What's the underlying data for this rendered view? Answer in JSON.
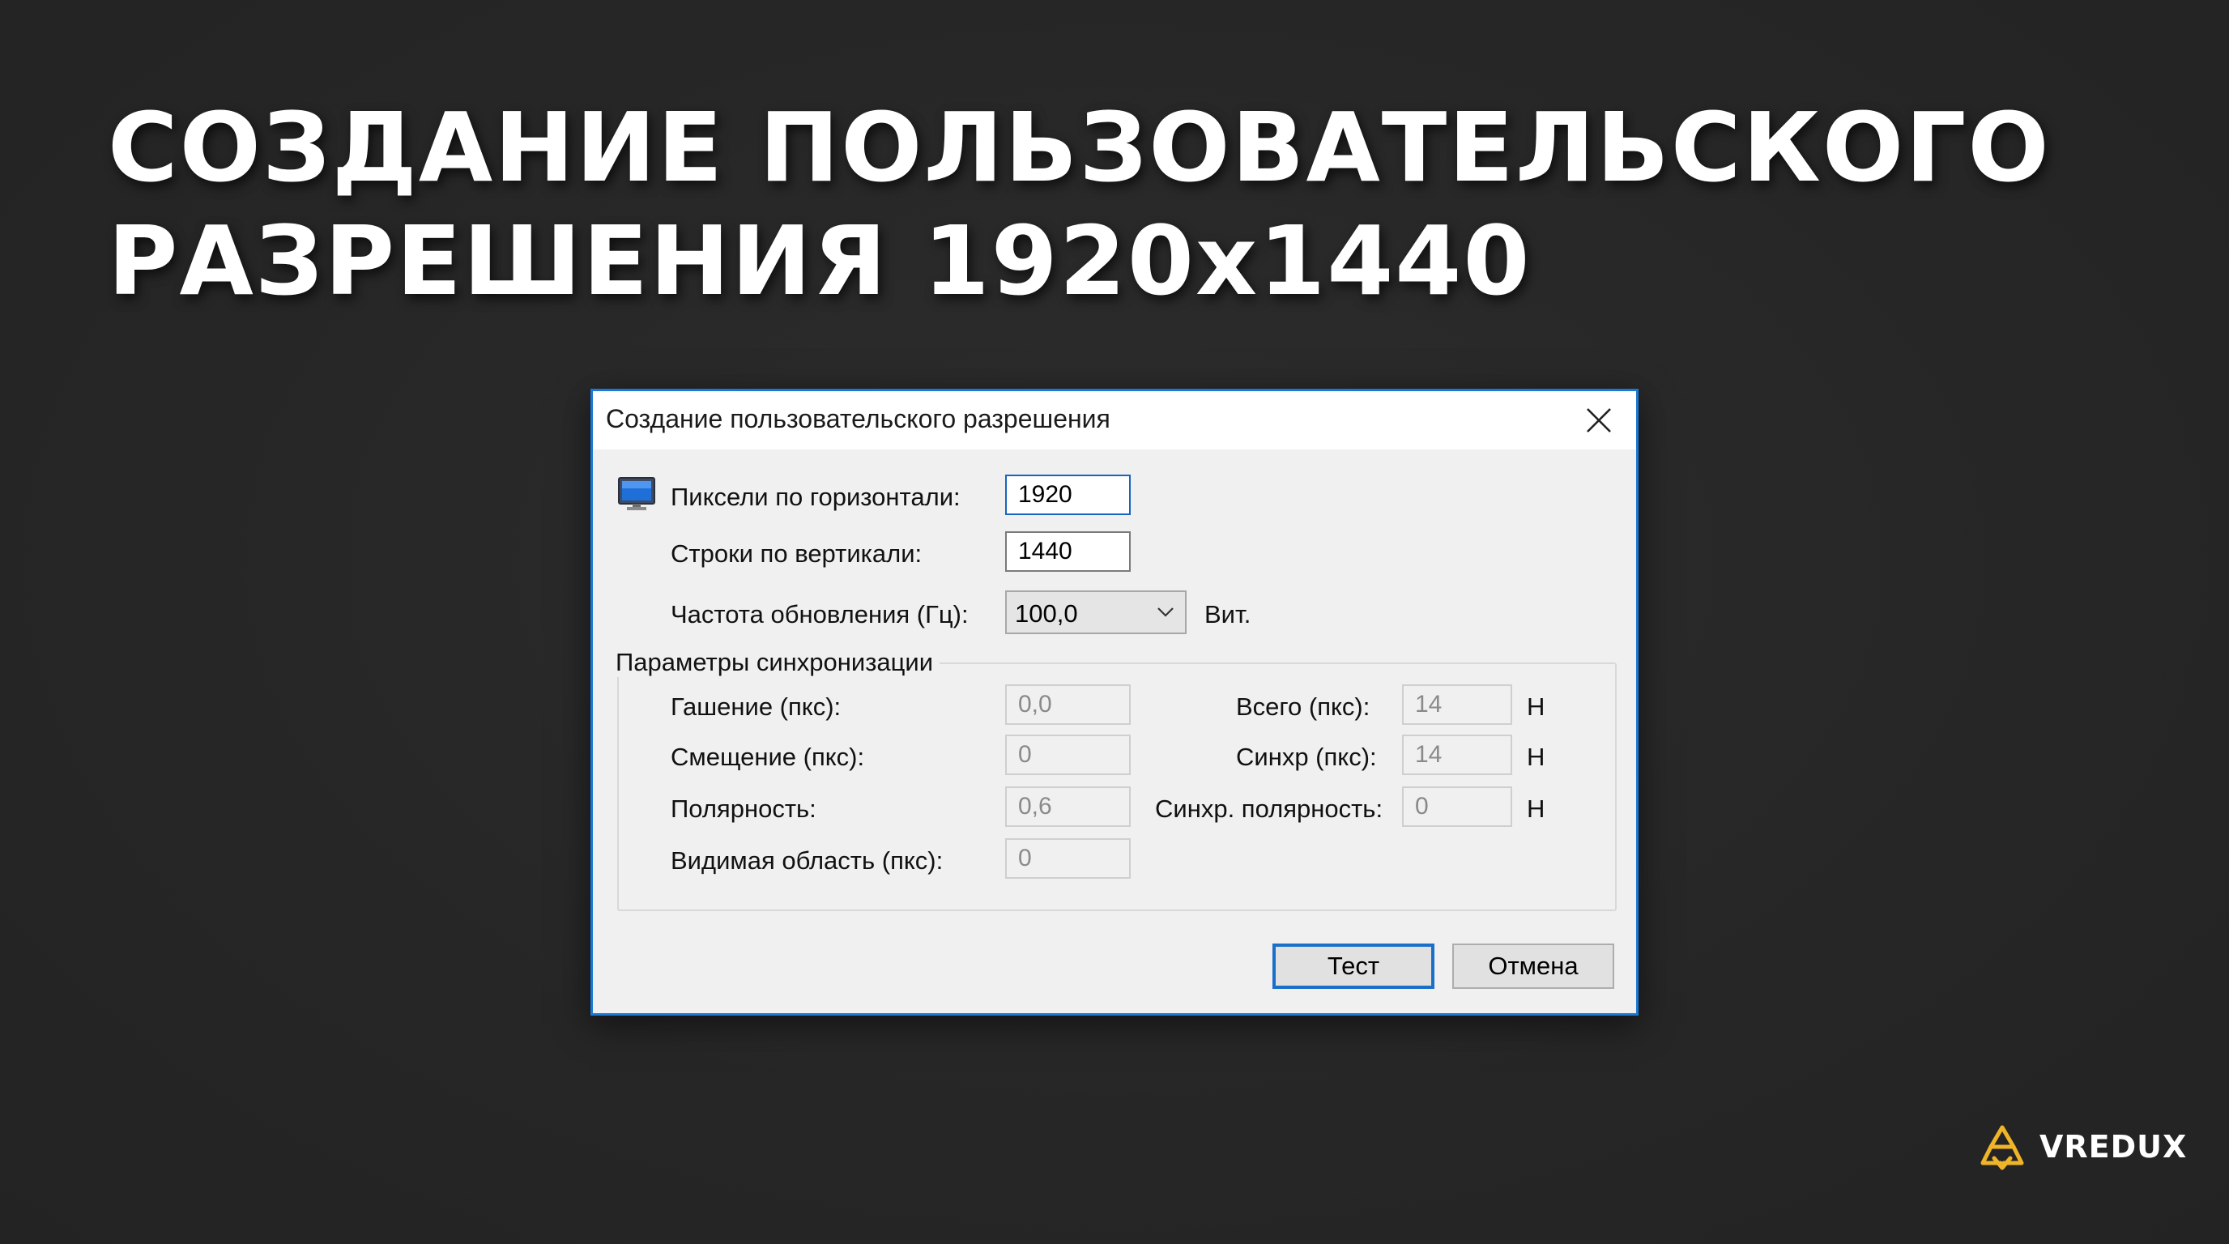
{
  "headline": {
    "line1": "СОЗДАНИЕ ПОЛЬЗОВАТЕЛЬСКОГО",
    "line2": "РАЗРЕШЕНИЯ 1920x1440"
  },
  "dialog": {
    "title": "Создание пользовательского разрешения",
    "horizontal_label": "Пиксели по горизонтали:",
    "horizontal_value": "1920",
    "vertical_label": "Строки по вертикали:",
    "vertical_value": "1440",
    "refresh_label": "Частота обновления (Гц):",
    "refresh_value": "100,0",
    "refresh_unit": "Вит.",
    "sync_group_label": "Параметры синхронизации",
    "blanking_label": "Гашение (пкс):",
    "blanking_value": "0,0",
    "offset_label": "Смещение (пкс):",
    "offset_value": "0",
    "polarity_label": "Полярность:",
    "polarity_value": "0,6",
    "visible_label": "Видимая область (пкс):",
    "visible_value": "0",
    "total_label": "Всего (пкс):",
    "total_value": "14",
    "total_unit": "Н",
    "sync_label": "Синхр (пкс):",
    "sync_value": "14",
    "sync_unit": "Н",
    "sync_polarity_label": "Синхр. полярность:",
    "sync_polarity_value": "0",
    "sync_polarity_unit": "Н",
    "test_button": "Тест",
    "cancel_button": "Отмена"
  },
  "logo": {
    "text": "VREDUX",
    "color": "#f0b428"
  },
  "colors": {
    "background": "#272727",
    "dialog_border": "#1a78d6",
    "focus_border": "#1565c0"
  }
}
